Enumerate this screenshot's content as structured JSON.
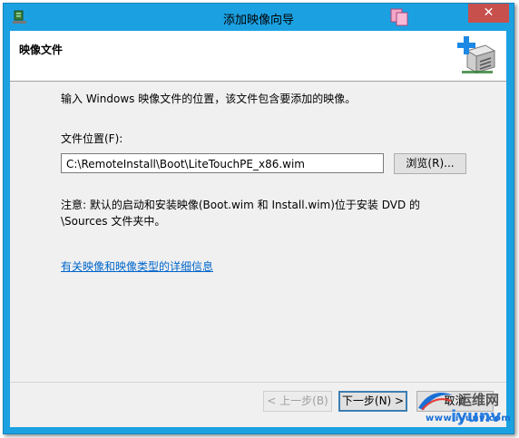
{
  "window": {
    "title": "添加映像向导",
    "close_label": "✕"
  },
  "header": {
    "title": "映像文件"
  },
  "content": {
    "intro": "输入 Windows 映像文件的位置，该文件包含要添加的映像。",
    "file_label": "文件位置(F):",
    "file_value": "C:\\RemoteInstall\\Boot\\LiteTouchPE_x86.wim",
    "browse_label": "浏览(R)...",
    "note": "注意: 默认的启动和安装映像(Boot.wim 和 Install.wim)位于安装 DVD 的 \\Sources 文件夹中。",
    "info_link": "有关映像和映像类型的详细信息"
  },
  "footer": {
    "back_label": "< 上一步(B)",
    "next_label": "下一步(N) >",
    "cancel_label": "取消"
  },
  "watermark": {
    "text": "运维网",
    "iyunv": "iyunv",
    "url": "www.iyunv.com"
  },
  "colors": {
    "titlebar": "#1ba1e2",
    "close": "#c7504c",
    "link": "#0066cc",
    "focus_border": "#3c7fb1"
  }
}
